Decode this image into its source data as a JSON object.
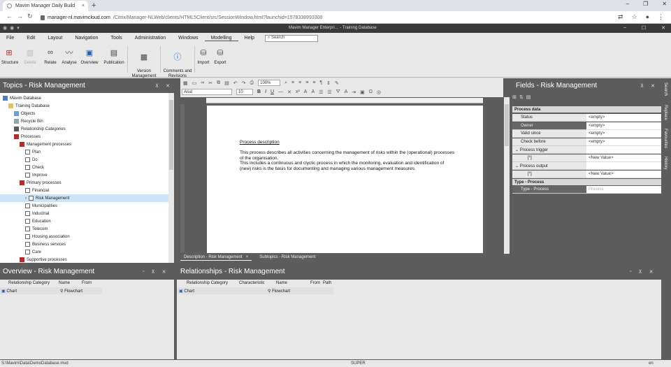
{
  "browser": {
    "tab_title": "Mavim Manager Daily Build",
    "tab_close": "×",
    "new_tab": "+",
    "url_host": "manager-nl.mavimcloud.com",
    "url_path": "/Citrix/Manager-NLWeb/clients/HTML5Client/src/SessionWindow.html?launchid=1578338993300",
    "window_buttons": [
      "–",
      "❐",
      "✕"
    ]
  },
  "app": {
    "title": "Mavim Manager Enterpri… - Training  Database",
    "window_buttons": [
      "–",
      "☐",
      "✕"
    ]
  },
  "menu": {
    "items": [
      "File",
      "Edit",
      "Layout",
      "Navigation",
      "Tools",
      "Administration",
      "Windows",
      "Modelling",
      "Help"
    ],
    "active": "Modelling",
    "search_placeholder": "Search"
  },
  "ribbon": {
    "structure": "Structure",
    "delete": "Delete",
    "relate": "Relate",
    "analyse": "Analyse",
    "overview": "Overview",
    "publication": "Publication",
    "version_mgmt": "Version\nManagement",
    "comments": "Comments and\nRevisions",
    "import": "Import",
    "export": "Export"
  },
  "topics": {
    "title": "Topics - Risk Management",
    "items": [
      {
        "label": "Mavim Database",
        "level": 0,
        "icon": "db"
      },
      {
        "label": "Training  Database",
        "level": 1,
        "icon": "fold"
      },
      {
        "label": "Objects",
        "level": 2,
        "icon": "obj"
      },
      {
        "label": "Recycle Bin",
        "level": 2,
        "icon": "bin"
      },
      {
        "label": "Relationship Categories",
        "level": 2,
        "icon": "rel"
      },
      {
        "label": "Processes",
        "level": 2,
        "icon": "proc"
      },
      {
        "label": "Management processes",
        "level": 3,
        "icon": "proc"
      },
      {
        "label": "Plan",
        "level": 4,
        "icon": "box"
      },
      {
        "label": "Do",
        "level": 4,
        "icon": "box"
      },
      {
        "label": "Check",
        "level": 4,
        "icon": "box"
      },
      {
        "label": "Improve",
        "level": 4,
        "icon": "box"
      },
      {
        "label": "Primary processes",
        "level": 3,
        "icon": "proc"
      },
      {
        "label": "Financial",
        "level": 4,
        "icon": "box"
      },
      {
        "label": "Risk Management",
        "level": 4,
        "icon": "box",
        "selected": true
      },
      {
        "label": "Municipalities",
        "level": 4,
        "icon": "box"
      },
      {
        "label": "Industrial",
        "level": 4,
        "icon": "box"
      },
      {
        "label": "Education",
        "level": 4,
        "icon": "box"
      },
      {
        "label": "Telecom",
        "level": 4,
        "icon": "box"
      },
      {
        "label": "Housing association",
        "level": 4,
        "icon": "box"
      },
      {
        "label": "Business services",
        "level": 4,
        "icon": "box"
      },
      {
        "label": "Care",
        "level": 4,
        "icon": "box"
      },
      {
        "label": "Supportive processes",
        "level": 3,
        "icon": "proc"
      }
    ]
  },
  "editor": {
    "zoom": "100%",
    "font": "Arial",
    "font_size": "10",
    "heading": "Process description",
    "paragraph": "This process describes all activities concerning the management of risks within the (operational) processes of the organisation.\nThis includes a continuous and clyclic process in which the monitoring, evaluation and identification of (new) risks is the basis for documenting and managing various management measures.",
    "tabs": [
      "Description - Risk Management",
      "Subtopics - Risk Management"
    ],
    "tab_close": "×"
  },
  "fields": {
    "title": "Fields - Risk Management",
    "section1": "Process data",
    "rows": [
      {
        "key": "Status",
        "value": "<empty>"
      },
      {
        "key": "Owner",
        "value": "<empty>",
        "dark": true
      },
      {
        "key": "Valid since",
        "value": "<empty>"
      },
      {
        "key": "Check before",
        "value": "<empty>"
      },
      {
        "key": "⌄  Process trigger",
        "value": ""
      },
      {
        "key": "[*]",
        "value": "<New Value>"
      },
      {
        "key": "⌄  Process output",
        "value": ""
      },
      {
        "key": "[*]",
        "value": "<New Value>"
      }
    ],
    "section2": "Type - Process",
    "type_key": "Type - Process",
    "type_value": "Process"
  },
  "side_tabs": [
    "Search",
    "Replace",
    "Favourites",
    "History"
  ],
  "overview": {
    "title": "Overview - Risk Management",
    "columns": [
      "Relationship Category",
      "Name",
      "From"
    ],
    "row": {
      "category": "Chart",
      "name": "Flowchart",
      "from": ""
    }
  },
  "relationships": {
    "title": "Relationships - Risk Management",
    "columns": [
      "Relationship Category",
      "Characteristic",
      "Name",
      "From",
      "Path"
    ],
    "row": {
      "category": "Chart",
      "characteristic": "",
      "name": "Flowchart",
      "from": "",
      "path": ""
    }
  },
  "status": {
    "path": "S:\\Mavim\\Data\\DemoDatabase.mvd",
    "user": "SUPER",
    "lang": "en"
  }
}
